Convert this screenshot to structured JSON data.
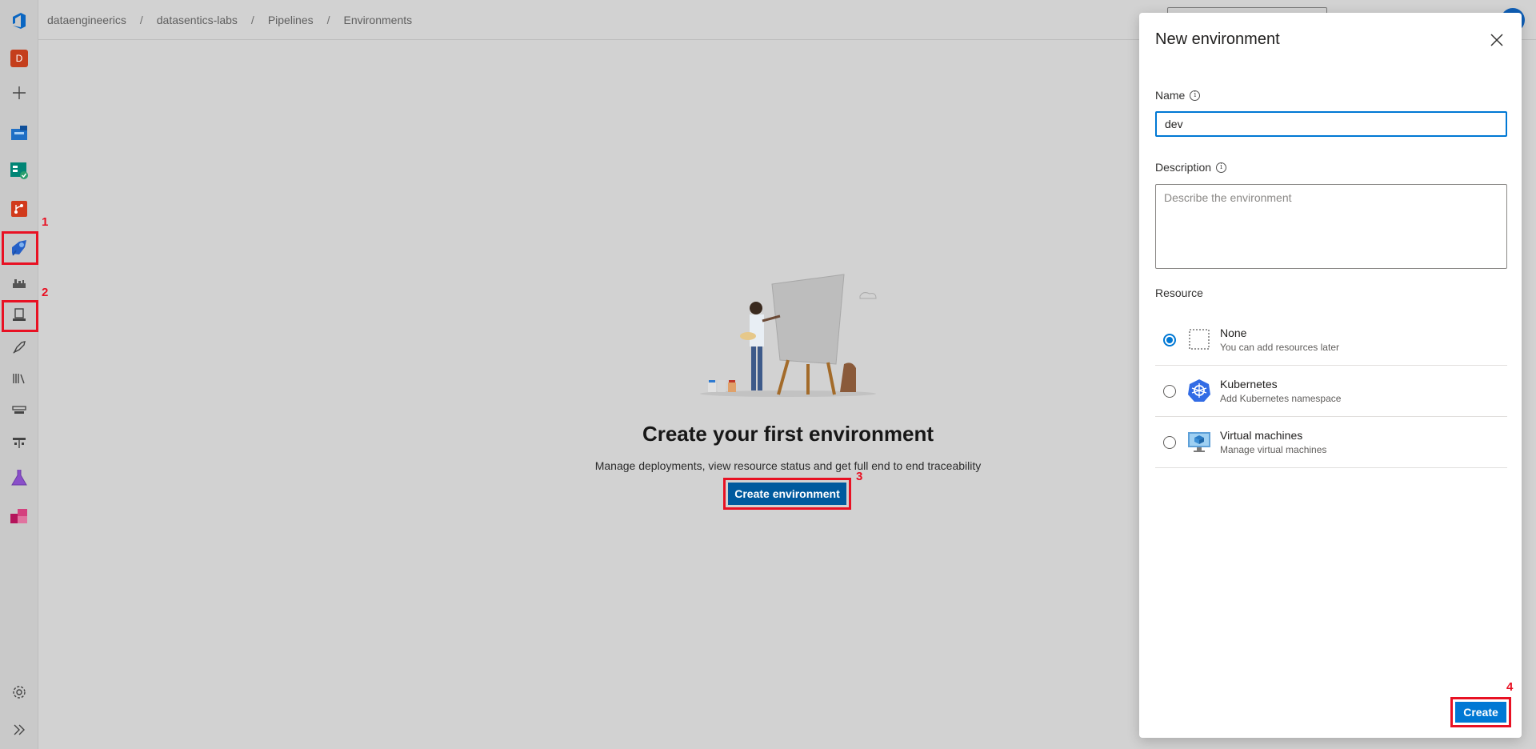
{
  "breadcrumb": [
    "dataengineerics",
    "datasentics-labs",
    "Pipelines",
    "Environments"
  ],
  "org_initial": "D",
  "annotations": {
    "n1": "1",
    "n2": "2",
    "n3": "3",
    "n4": "4"
  },
  "empty_state": {
    "title": "Create your first environment",
    "subtitle": "Manage deployments, view resource status and get full end to end traceability",
    "button": "Create environment"
  },
  "panel": {
    "title": "New environment",
    "name_label": "Name",
    "name_value": "dev",
    "description_label": "Description",
    "description_placeholder": "Describe the environment",
    "resource_label": "Resource",
    "resources": [
      {
        "name": "None",
        "desc": "You can add resources later",
        "selected": true
      },
      {
        "name": "Kubernetes",
        "desc": "Add Kubernetes namespace",
        "selected": false
      },
      {
        "name": "Virtual machines",
        "desc": "Manage virtual machines",
        "selected": false
      }
    ],
    "create_button": "Create"
  },
  "colors": {
    "accent": "#0078d4",
    "highlight": "#e81123"
  }
}
